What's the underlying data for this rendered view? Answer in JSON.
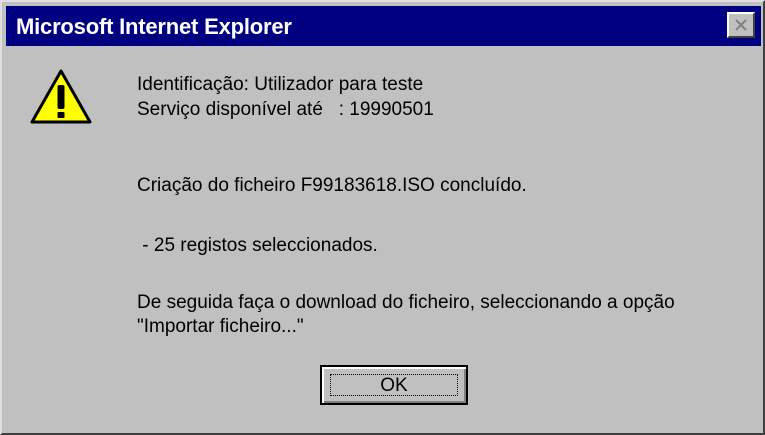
{
  "window": {
    "title": "Microsoft Internet Explorer",
    "close_icon": "close-x-icon"
  },
  "dialog": {
    "icon": "warning-icon",
    "lines": [
      "Identificação: Utilizador para teste",
      "Serviço disponível até   : 19990501",
      "Criação do ficheiro F99183618.ISO concluído.",
      " - 25 registos seleccionados.",
      "De seguida faça o download do ficheiro, seleccionando a opção",
      "\"Importar ficheiro...\""
    ],
    "ok_label": "OK"
  },
  "colors": {
    "titlebar": "#000080",
    "face": "#c0c0c0",
    "warning_yellow": "#ffff00"
  }
}
